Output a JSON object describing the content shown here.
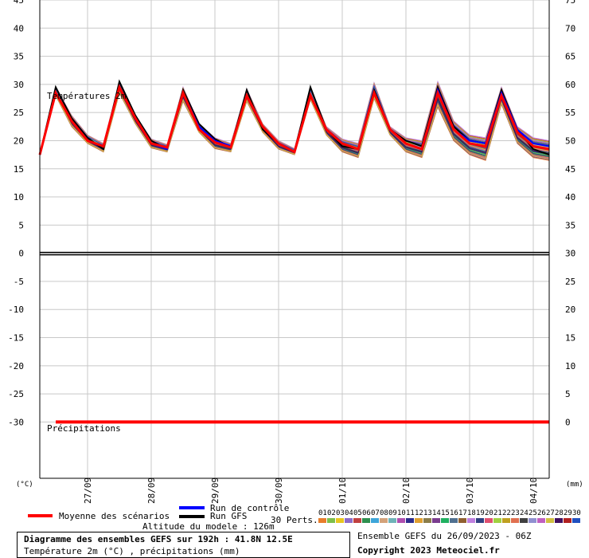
{
  "chart_data": {
    "type": "line",
    "left_axis_unit": "(°C)",
    "right_axis_unit": "(mm)",
    "top_panel_label": "Températures 2m",
    "bottom_panel_label": "Précipitations",
    "temp_axis": {
      "range": [
        -40,
        45
      ],
      "ticks": [
        45,
        40,
        35,
        30,
        25,
        20,
        15,
        10,
        5,
        0,
        -5,
        -10,
        -15,
        -20,
        -25,
        -30
      ]
    },
    "right_axis": {
      "ticks": [
        75,
        70,
        65,
        60,
        55,
        50,
        45,
        40,
        35,
        30,
        25,
        20,
        15,
        10,
        5,
        0
      ]
    },
    "x_axis": {
      "unit": "hours",
      "range": [
        0,
        192
      ],
      "date_labels": [
        {
          "label": "27/09",
          "hour": 18
        },
        {
          "label": "28/09",
          "hour": 42
        },
        {
          "label": "29/09",
          "hour": 66
        },
        {
          "label": "30/09",
          "hour": 90
        },
        {
          "label": "01/10",
          "hour": 114
        },
        {
          "label": "02/10",
          "hour": 138
        },
        {
          "label": "03/10",
          "hour": 162
        },
        {
          "label": "04/10",
          "hour": 186
        }
      ]
    },
    "hours": [
      0,
      6,
      12,
      18,
      24,
      30,
      36,
      42,
      48,
      54,
      60,
      66,
      72,
      78,
      84,
      90,
      96,
      102,
      108,
      114,
      120,
      126,
      132,
      138,
      144,
      150,
      156,
      162,
      168,
      174,
      180,
      186,
      192
    ],
    "temperature_mean": [
      17.5,
      28.5,
      23.5,
      20,
      19,
      29.5,
      24,
      19.5,
      18.8,
      28.5,
      22,
      19.7,
      18.8,
      28,
      22.5,
      19.5,
      18,
      28,
      22,
      19.5,
      18.5,
      28.5,
      22,
      19.5,
      18.5,
      28.5,
      22,
      19.5,
      19,
      28,
      21.5,
      19,
      18.5
    ],
    "temperature_gfs": [
      17.5,
      29.5,
      24,
      20.5,
      18.5,
      30.5,
      24.5,
      20,
      18.5,
      29,
      23,
      20.3,
      18.8,
      29,
      22,
      19.5,
      18,
      29.5,
      22,
      19,
      18.5,
      29,
      22,
      20,
      19,
      29.5,
      22.5,
      20,
      19.5,
      29,
      22,
      18.5,
      17.5
    ],
    "temperature_control": [
      17.5,
      28.5,
      23.5,
      20,
      19,
      29.5,
      24,
      19.5,
      18.5,
      28.5,
      22.5,
      20,
      19,
      28,
      22.5,
      19.5,
      18,
      28,
      22,
      19.5,
      18.5,
      28.5,
      22,
      19.5,
      18.5,
      29,
      22,
      20,
      19.5,
      28.5,
      22,
      19.5,
      19
    ],
    "member_spread": {
      "upper": [
        17.5,
        29.5,
        24.5,
        21,
        19.5,
        30.5,
        24.5,
        20.3,
        19.3,
        29.5,
        23,
        20.5,
        19.5,
        29.2,
        23,
        20,
        18.6,
        29.5,
        22.5,
        20.3,
        19.5,
        30.3,
        22.5,
        20.5,
        20,
        30.5,
        23.5,
        21,
        20.5,
        29.5,
        22.5,
        20.5,
        20
      ],
      "lower": [
        17.5,
        28,
        22.5,
        19.5,
        18,
        28.5,
        23,
        18.7,
        18,
        27,
        21.5,
        18.6,
        18,
        27,
        21.5,
        18.5,
        17.5,
        27.3,
        21,
        18,
        17,
        27.5,
        21,
        18,
        17,
        26,
        20,
        17.5,
        16.5,
        26.5,
        19.5,
        17,
        16.5
      ]
    },
    "precipitation_mean": 0,
    "member_count": "30 Perts.",
    "member_ids": [
      "01",
      "02",
      "03",
      "04",
      "05",
      "06",
      "07",
      "08",
      "09",
      "10",
      "11",
      "12",
      "13",
      "14",
      "15",
      "16",
      "17",
      "18",
      "19",
      "20",
      "21",
      "22",
      "23",
      "24",
      "25",
      "26",
      "27",
      "28",
      "29",
      "30"
    ],
    "member_colors": [
      "#e87d2c",
      "#7dbf4a",
      "#e8c61f",
      "#8c6cc9",
      "#c04040",
      "#2f8f4f",
      "#3da5d9",
      "#d3a27a",
      "#6fb3b8",
      "#b04fb0",
      "#2c2c8c",
      "#e0a030",
      "#8b7d4a",
      "#7a3d8f",
      "#20b060",
      "#507090",
      "#906030",
      "#c080e0",
      "#304080",
      "#e05070",
      "#a0d040",
      "#c0a020",
      "#e07050",
      "#404040",
      "#9090d0",
      "#c060c0",
      "#d0c040",
      "#401060",
      "#b02020",
      "#2050c0"
    ],
    "legend": {
      "mean": "Moyenne des scénarios",
      "control": "Run de contrôle",
      "gfs": "Run GFS"
    },
    "colors": {
      "mean": "#ff0000",
      "control": "#0000ff",
      "gfs": "#000000",
      "grid": "#c8c8c8"
    }
  },
  "altitude": "Altitude du modele : 126m",
  "footer": {
    "title": "Diagramme des ensembles GEFS sur 192h : 41.8N 12.5E",
    "subtitle": "Température 2m (°C) , précipitations (mm)",
    "run_info": "Ensemble GEFS du 26/09/2023 - 06Z",
    "copyright": "Copyright 2023 Meteociel.fr"
  }
}
